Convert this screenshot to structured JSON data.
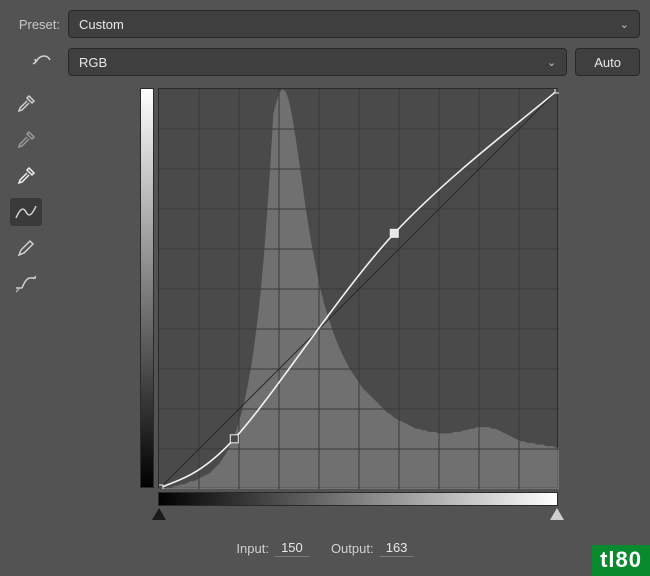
{
  "preset": {
    "label": "Preset:",
    "value": "Custom"
  },
  "channel": {
    "value": "RGB"
  },
  "autoButton": "Auto",
  "tools": [
    {
      "name": "eyedropper-black",
      "active": false
    },
    {
      "name": "eyedropper-gray",
      "active": false
    },
    {
      "name": "eyedropper-white",
      "active": false
    },
    {
      "name": "curve-point",
      "active": true
    },
    {
      "name": "pencil",
      "active": false
    },
    {
      "name": "clip-smooth",
      "active": false
    }
  ],
  "input": {
    "label": "Input:",
    "value": "150"
  },
  "output": {
    "label": "Output:",
    "value": "163"
  },
  "watermark": "tl80",
  "chart_data": {
    "type": "curve-editor",
    "grid_divisions": 10,
    "x_range": [
      0,
      255
    ],
    "y_range": [
      0,
      255
    ],
    "diagonal_reference": true,
    "curve_points": [
      {
        "x": 0,
        "y": 0
      },
      {
        "x": 48,
        "y": 32
      },
      {
        "x": 150,
        "y": 163
      },
      {
        "x": 255,
        "y": 255
      }
    ],
    "selected_point_index": 2,
    "histogram": [
      0,
      0,
      1,
      1,
      1,
      2,
      2,
      3,
      3,
      4,
      5,
      5,
      6,
      7,
      8,
      9,
      10,
      12,
      14,
      16,
      19,
      22,
      26,
      30,
      35,
      41,
      48,
      56,
      66,
      77,
      90,
      106,
      124,
      146,
      172,
      202,
      236,
      244,
      250,
      252,
      250,
      244,
      234,
      222,
      208,
      194,
      180,
      167,
      155,
      144,
      134,
      125,
      117,
      110,
      104,
      98,
      93,
      88,
      84,
      80,
      76,
      73,
      70,
      67,
      64,
      62,
      60,
      58,
      56,
      54,
      52,
      50,
      48,
      47,
      45,
      44,
      43,
      42,
      41,
      40,
      39,
      38,
      38,
      37,
      37,
      36,
      36,
      36,
      35,
      35,
      35,
      35,
      35,
      36,
      36,
      36,
      37,
      37,
      38,
      38,
      39,
      39,
      39,
      39,
      39,
      38,
      38,
      37,
      36,
      35,
      34,
      33,
      32,
      31,
      30,
      30,
      29,
      29,
      29,
      28,
      28,
      28,
      27,
      27,
      27,
      26,
      26
    ]
  }
}
